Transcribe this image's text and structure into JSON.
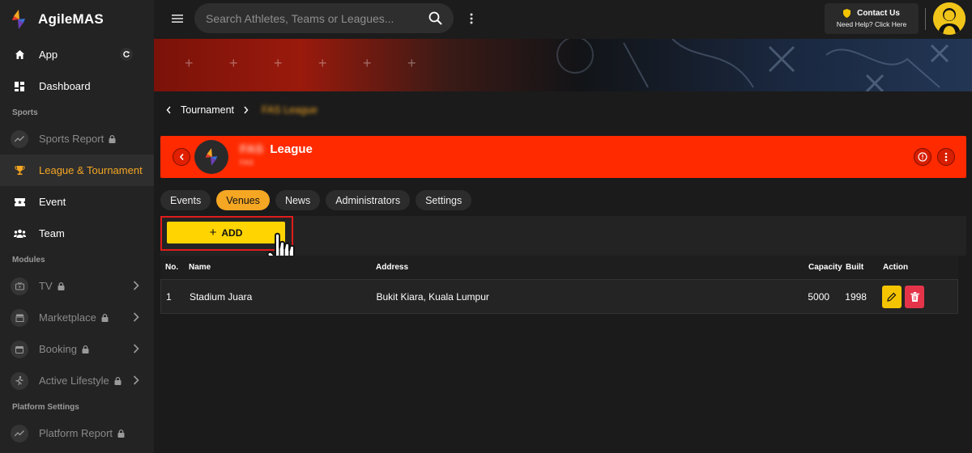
{
  "app": {
    "name": "AgileMAS",
    "brand_color": "#f5a623"
  },
  "sidebar": {
    "items_top": [
      {
        "label": "App",
        "icon": "home-icon"
      },
      {
        "label": "Dashboard",
        "icon": "dashboard-icon"
      }
    ],
    "section_sports": "Sports",
    "sports_items": [
      {
        "label": "Sports Report",
        "icon": "trend-icon",
        "locked": true
      },
      {
        "label": "League & Tournament",
        "icon": "trophy-icon",
        "active": true
      },
      {
        "label": "Event",
        "icon": "ticket-icon"
      },
      {
        "label": "Team",
        "icon": "group-icon"
      }
    ],
    "section_modules": "Modules",
    "module_items": [
      {
        "label": "TV",
        "icon": "tv-icon",
        "locked": true
      },
      {
        "label": "Marketplace",
        "icon": "store-icon",
        "locked": true
      },
      {
        "label": "Booking",
        "icon": "booking-icon",
        "locked": true
      },
      {
        "label": "Active Lifestyle",
        "icon": "run-icon",
        "locked": true
      }
    ],
    "section_platform": "Platform Settings",
    "platform_items": [
      {
        "label": "Platform Report",
        "icon": "trend-icon",
        "locked": true
      }
    ]
  },
  "topbar": {
    "search_placeholder": "Search Athletes, Teams or Leagues...",
    "contact_title": "Contact Us",
    "contact_sub": "Need Help? Click Here"
  },
  "breadcrumb": {
    "parent": "Tournament",
    "current": "FAS League"
  },
  "league": {
    "name_prefix": "FAS",
    "name": "League",
    "subtitle": "FAS",
    "header_color": "#ff2a00"
  },
  "tabs": [
    "Events",
    "Venues",
    "News",
    "Administrators",
    "Settings"
  ],
  "active_tab": "Venues",
  "toolbar": {
    "add_label": "ADD"
  },
  "table": {
    "headers": {
      "no": "No.",
      "name": "Name",
      "address": "Address",
      "capacity": "Capacity",
      "built": "Built",
      "action": "Action"
    },
    "rows": [
      {
        "no": "1",
        "name": "Stadium Juara",
        "address": "Bukit Kiara, Kuala Lumpur",
        "capacity": "5000",
        "built": "1998"
      }
    ]
  }
}
